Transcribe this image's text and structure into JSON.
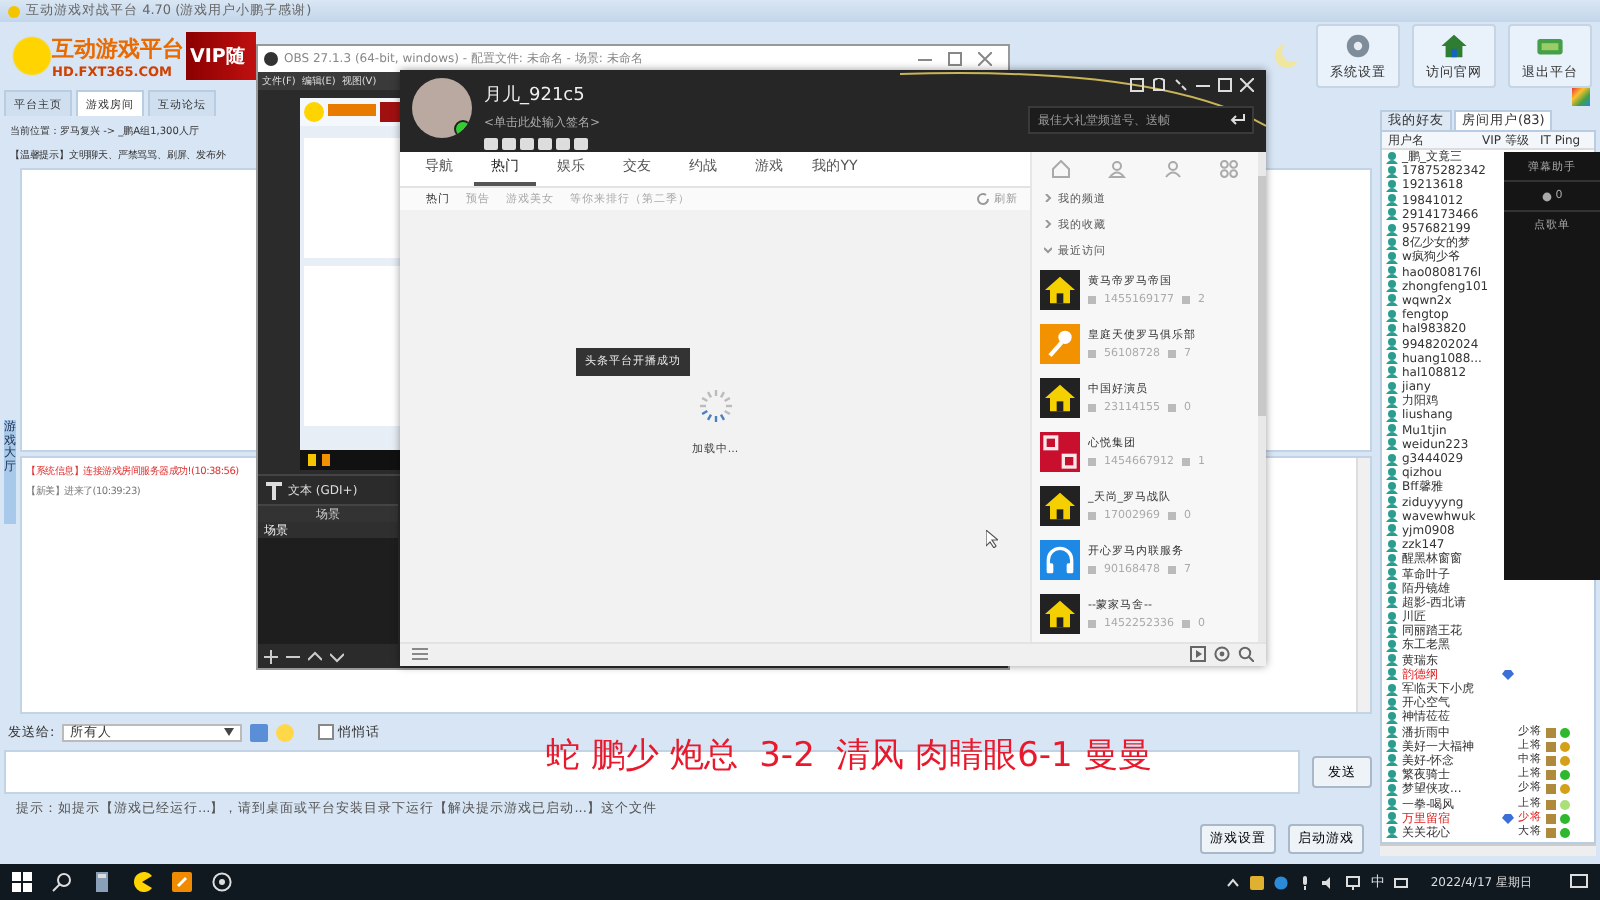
{
  "platform": {
    "title": "互动游戏对战平台 4.70 (游戏用户小鹏子感谢)",
    "logo": {
      "name": "互动游戏平台",
      "site": "HD.FXT365.COM"
    },
    "banner": "VIP随",
    "toolbar": [
      {
        "label": "系统设置",
        "kind": "gear"
      },
      {
        "label": "访问官网",
        "kind": "house"
      },
      {
        "label": "退出平台",
        "kind": "exit"
      }
    ],
    "tabs": [
      {
        "label": "平台主页",
        "selected": false
      },
      {
        "label": "游戏房间",
        "selected": true
      },
      {
        "label": "互动论坛",
        "selected": false
      }
    ],
    "location": "当前位置：罗马复兴 -> _鹏A组1,300人厅",
    "notice": "【温馨提示】文明聊天、严禁骂骂、刷屏、发布外",
    "side_tab": "游戏大厅",
    "chat": [
      {
        "kind": "system",
        "text": "【系统信息】连接游戏房间服务器成功!(10:38:56)"
      },
      {
        "kind": "user",
        "text": "【新美】进来了(10:39:23)"
      }
    ],
    "send_to": {
      "label": "发送给:",
      "value": "所有人"
    },
    "whisper": {
      "label": "悄悄话",
      "checked": false
    },
    "send_button": "发送",
    "hint": "提示：如提示【游戏已经运行...】，请到桌面或平台安装目录下运行【解决提示游戏已启动...】这个文件",
    "buttons": [
      "游戏设置",
      "启动游戏"
    ],
    "user_panel": {
      "tabs": [
        {
          "label": "我的好友",
          "selected": false
        },
        {
          "label": "房间用户(83)",
          "selected": true
        }
      ],
      "columns": [
        "用户名",
        "VIP 等级",
        "IT Ping"
      ],
      "users": [
        {
          "name": "_鹏_文竟三",
          "vip": false
        },
        {
          "name": "17875282342",
          "vip": false
        },
        {
          "name": "19213618",
          "vip": false
        },
        {
          "name": "19841012",
          "vip": false
        },
        {
          "name": "2914173466",
          "vip": false
        },
        {
          "name": "957682199",
          "vip": false
        },
        {
          "name": "8亿少女的梦",
          "vip": false
        },
        {
          "name": "w疯狗少爷",
          "vip": false
        },
        {
          "name": "hao0808176l",
          "vip": false
        },
        {
          "name": "zhongfeng101",
          "vip": false
        },
        {
          "name": "wqwn2x",
          "vip": false
        },
        {
          "name": "fengtop",
          "vip": false
        },
        {
          "name": "hal983820",
          "vip": false
        },
        {
          "name": "9948202024",
          "vip": false
        },
        {
          "name": "huang1088...",
          "vip": false
        },
        {
          "name": "hal108812",
          "vip": false
        },
        {
          "name": "jiany",
          "vip": false
        },
        {
          "name": "力阳鸡",
          "vip": false
        },
        {
          "name": "liushang",
          "vip": false
        },
        {
          "name": "Mu1tjin",
          "vip": false
        },
        {
          "name": "weidun223",
          "vip": false
        },
        {
          "name": "g3444029",
          "vip": false
        },
        {
          "name": "qizhou",
          "vip": false
        },
        {
          "name": "Bff馨雅",
          "vip": false
        },
        {
          "name": "ziduyyyng",
          "vip": false
        },
        {
          "name": "wavewhwuk",
          "vip": false
        },
        {
          "name": "yjm0908",
          "vip": false
        },
        {
          "name": "zzk147",
          "vip": false
        },
        {
          "name": "醒黑林窗窗",
          "vip": false
        },
        {
          "name": "革命叶子",
          "vip": false
        },
        {
          "name": "陌丹镜雄",
          "vip": false
        },
        {
          "name": "超影-西北请",
          "vip": false
        },
        {
          "name": "川匠",
          "vip": false
        },
        {
          "name": "同丽踏王花",
          "vip": false
        },
        {
          "name": "东工老黑",
          "vip": false
        },
        {
          "name": "黄瑞东",
          "vip": false
        },
        {
          "name": "韵德纲",
          "vip": true
        },
        {
          "name": "军临天下小虎",
          "vip": false
        },
        {
          "name": "开心空气",
          "vip": false
        },
        {
          "name": "神情莅莅",
          "vip": false
        },
        {
          "name": "潘折雨中",
          "vip": false,
          "rank": "少将",
          "color": "#2db82d"
        },
        {
          "name": "美好一大福神",
          "vip": false,
          "rank": "上将",
          "color": "#d4a017"
        },
        {
          "name": "美好-怀念",
          "vip": false,
          "rank": "中将",
          "color": "#d4a017"
        },
        {
          "name": "繁夜骑士",
          "vip": false,
          "rank": "上将",
          "color": "#2db82d"
        },
        {
          "name": "梦望侠攻...",
          "vip": false,
          "rank": "少将",
          "color": "#d4a017"
        },
        {
          "name": "一拳-喝风",
          "vip": false,
          "rank": "上将",
          "color": "#a8e07a"
        },
        {
          "name": "万里留宿",
          "vip": true,
          "rank": "少将",
          "color": "#2db82d"
        },
        {
          "name": "关关花心",
          "vip": false,
          "rank": "大将",
          "color": "#2db82d"
        }
      ]
    }
  },
  "obs": {
    "title": "OBS 27.1.3 (64-bit, windows) - 配置文件: 未命名 - 场景: 未命名",
    "menu": [
      "文件(F)",
      "编辑(E)",
      "视图(V)"
    ],
    "source": "文本 (GDI+)",
    "scenes_header": "场景",
    "scenes": [
      "场景"
    ]
  },
  "yy": {
    "user": {
      "name": "月儿_921c5",
      "signature": "<单击此处输入签名>"
    },
    "search": {
      "placeholder": "最佳大礼堂频道号、送帧"
    },
    "nav": [
      {
        "label": "导航",
        "selected": false
      },
      {
        "label": "热门",
        "selected": true
      },
      {
        "label": "娱乐",
        "selected": false
      },
      {
        "label": "交友",
        "selected": false
      },
      {
        "label": "约战",
        "selected": false
      },
      {
        "label": "游戏",
        "selected": false
      },
      {
        "label": "我的YY",
        "selected": false
      }
    ],
    "subtabs": [
      {
        "label": "热门",
        "selected": true
      },
      {
        "label": "预告",
        "selected": false
      },
      {
        "label": "游戏美女",
        "selected": false
      },
      {
        "label": "等你来排行（第二季）",
        "selected": false
      }
    ],
    "refresh": "刷新",
    "toast": "头条平台开播成功",
    "loading": "加载中...",
    "tree": [
      {
        "label": "我的频道",
        "expanded": false
      },
      {
        "label": "我的收藏",
        "expanded": false
      },
      {
        "label": "最近访问",
        "expanded": true
      }
    ],
    "channels": [
      {
        "name": "黄马帝罗马帝国",
        "id": "1455169177",
        "count": "2",
        "kind": "house"
      },
      {
        "name": "皇庭天使罗马俱乐部",
        "id": "56108728",
        "count": "7",
        "kind": "mic"
      },
      {
        "name": "中国好演员",
        "id": "23114155",
        "count": "0",
        "kind": "house"
      },
      {
        "name": "心悦集团",
        "id": "1454667912",
        "count": "1",
        "kind": "seal"
      },
      {
        "name": "_天尚_罗马战队",
        "id": "17002969",
        "count": "0",
        "kind": "house"
      },
      {
        "name": "开心罗马内联服务",
        "id": "90168478",
        "count": "7",
        "kind": "headphones"
      },
      {
        "name": "--蒙家马舍--",
        "id": "1452252336",
        "count": "0",
        "kind": "house"
      }
    ]
  },
  "danmu": {
    "title": "弹幕助手",
    "count": "0",
    "label": "点歌单"
  },
  "caption": "蛇 鹏少 炮总  3-2  清风 肉睛眼6-1 曼曼",
  "taskbar": {
    "ime": "中",
    "date": "2022/4/17 星期日"
  }
}
